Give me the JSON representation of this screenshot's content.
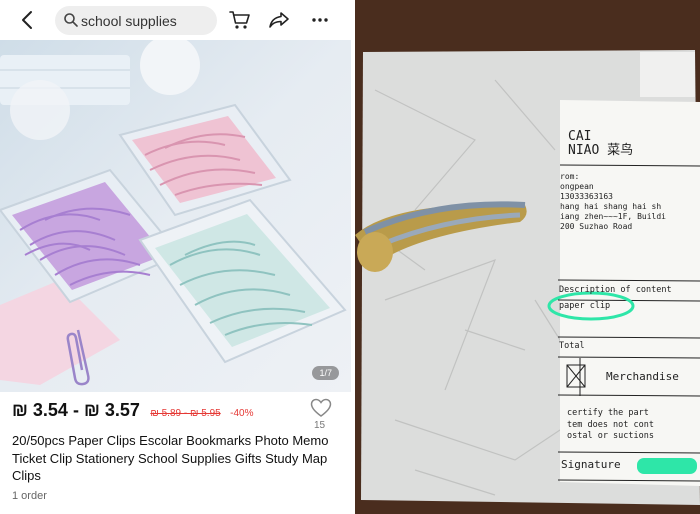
{
  "listing": {
    "search_query": "school supplies",
    "image_counter": "1/7",
    "price": "₪ 3.54 - ₪ 3.57",
    "original_price": "₪ 5.89 - ₪ 5.95",
    "discount": "-40%",
    "wishlist_count": "15",
    "title": "20/50pcs Paper Clips Escolar Bookmarks Photo Memo Ticket Clip Stationery School Supplies Gifts Study Map Clips",
    "orders": "1 order"
  },
  "package_label": {
    "logo_line1": "CAI",
    "logo_line2": "NIAO 菜鸟",
    "from_lines": [
      "rom:",
      "ongpean",
      "13033363163",
      "hang hai  shang hai sh",
      "iang zhen~~~1F, Buildi",
      "200 Suzhao Road"
    ],
    "description_label": "Description of content",
    "description_value": "paper clip",
    "total_label": "Total",
    "merchandise_label": "Merchandise",
    "certify_lines": [
      "certify the part",
      "tem does not cont",
      "ostal or suctions"
    ],
    "signature_label": "Signature"
  },
  "colors": {
    "price_red": "#e53935",
    "highlight_circle": "#2ee6a8"
  }
}
